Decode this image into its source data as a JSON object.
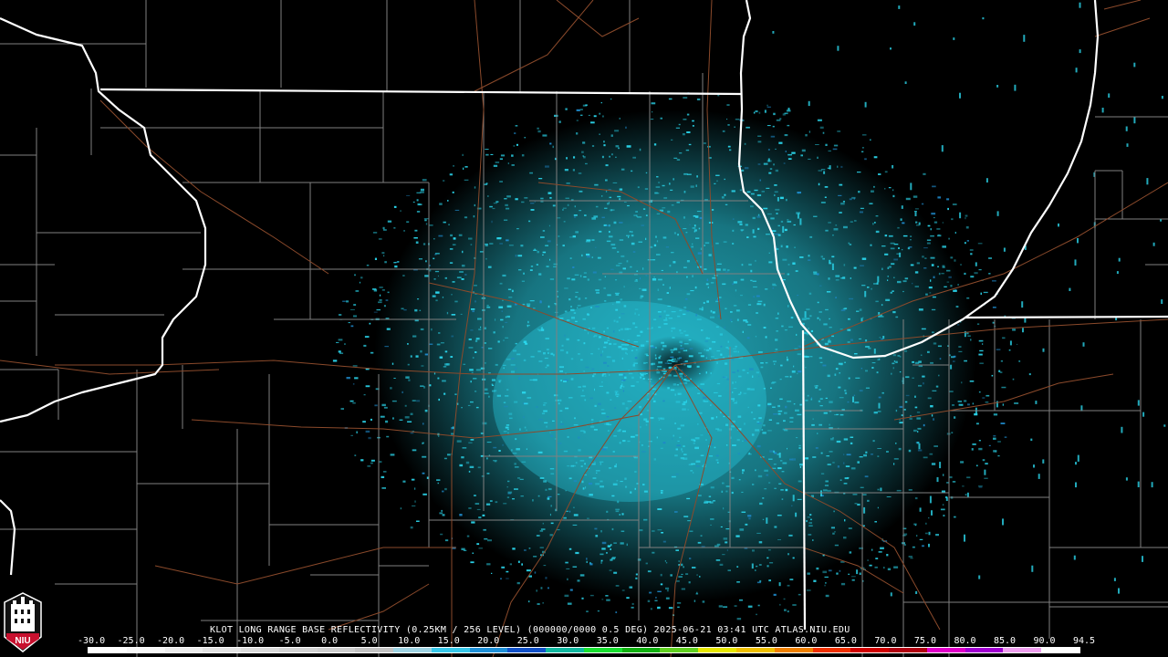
{
  "caption": "KLOT LONG RANGE BASE REFLECTIVITY (0.25KM / 256 LEVEL) (000000/0000 0.5 DEG) 2025-06-21 03:41 UTC  ATLAS.NIU.EDU",
  "logo": {
    "text": "NIU"
  },
  "colors": {
    "background": "#000000",
    "text": "#ffffff",
    "state_border": "#ffffff",
    "county_border": "#808080",
    "road": "#8b4a2b",
    "echo_main": "#2ad4ea",
    "echo_dark": "#1e88c8",
    "logo_red": "#c8102e"
  },
  "scale": {
    "labels": [
      "-30.0",
      "-25.0",
      "-20.0",
      "-15.0",
      "-10.0",
      "-5.0",
      "0.0",
      "5.0",
      "10.0",
      "15.0",
      "20.0",
      "25.0",
      "30.0",
      "35.0",
      "40.0",
      "45.0",
      "50.0",
      "55.0",
      "60.0",
      "65.0",
      "70.0",
      "75.0",
      "80.0",
      "85.0",
      "90.0",
      "94.5"
    ],
    "colors": [
      "#ffffff",
      "#f8f8f8",
      "#eeeeee",
      "#e4e4e4",
      "#dcdcdc",
      "#d4d4d4",
      "#cfcfcf",
      "#c4c4c4",
      "#9fd4e4",
      "#37c8ea",
      "#1e90d8",
      "#1050c8",
      "#10b8a0",
      "#18e030",
      "#10b010",
      "#60d020",
      "#e8e800",
      "#f0c000",
      "#f08000",
      "#f03000",
      "#d00000",
      "#b00010",
      "#e000c8",
      "#a000d0",
      "#f0a0f0",
      "#ffffff"
    ]
  }
}
